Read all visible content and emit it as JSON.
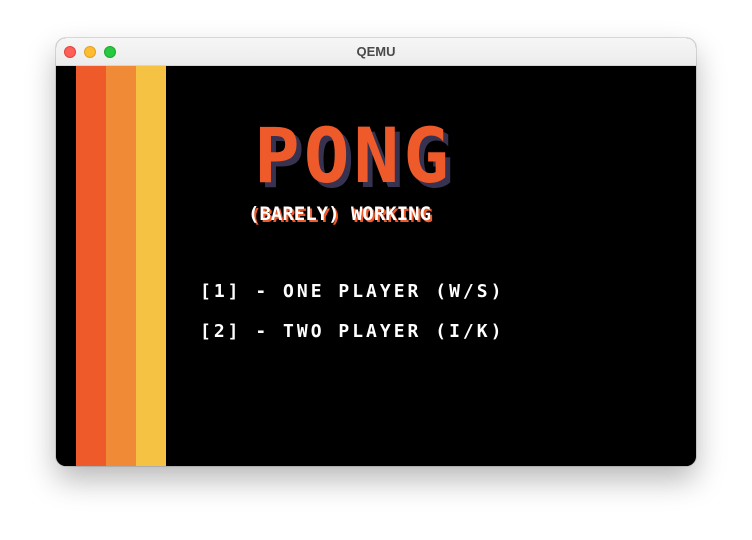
{
  "window": {
    "title": "QEMU"
  },
  "game": {
    "title": "PONG",
    "subtitle": "(BARELY) WORKING",
    "menu": [
      {
        "label": "[1] - ONE PLAYER (W/S)"
      },
      {
        "label": "[2] - TWO PLAYER (I/K)"
      }
    ]
  },
  "colors": {
    "stripe_red": "#ef5a2b",
    "stripe_orange": "#f08a36",
    "stripe_yellow": "#f6c244",
    "logo": "#ef5a2b",
    "logo_shadow": "#37324f",
    "background": "#000000",
    "menu_text": "#ffffff"
  }
}
